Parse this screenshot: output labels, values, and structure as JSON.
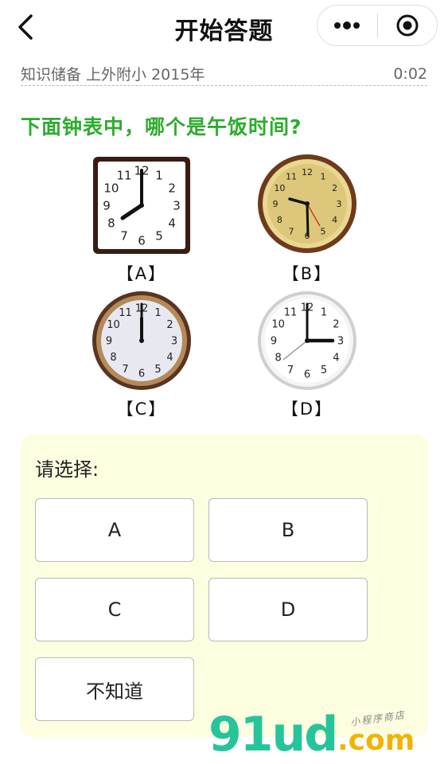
{
  "header": {
    "title": "开始答题",
    "back_icon": "chevron-left-icon",
    "more_icon": "more-dots-icon",
    "close_icon": "target-circle-icon"
  },
  "info": {
    "category": "知识储备 上外附小 2015年",
    "timer": "0:02"
  },
  "question": {
    "text": "下面钟表中，哪个是午饭时间?",
    "color": "#2dac2d"
  },
  "clocks": [
    {
      "label": "【A】",
      "time": "8:00",
      "style": "square-wooden"
    },
    {
      "label": "【B】",
      "time": "5:45",
      "style": "round-gold"
    },
    {
      "label": "【C】",
      "time": "12:00",
      "style": "round-bronze"
    },
    {
      "label": "【D】",
      "time": "3:00",
      "style": "round-silver"
    }
  ],
  "clock_numbers": [
    "12",
    "1",
    "2",
    "3",
    "4",
    "5",
    "6",
    "7",
    "8",
    "9",
    "10",
    "11"
  ],
  "answer_panel": {
    "prompt": "请选择:",
    "background": "#fdfde0",
    "options": [
      "A",
      "B",
      "C",
      "D",
      "不知道"
    ]
  },
  "watermark": {
    "brand": "91ud",
    "suffix": ".com",
    "tagline": "小程序商店"
  }
}
